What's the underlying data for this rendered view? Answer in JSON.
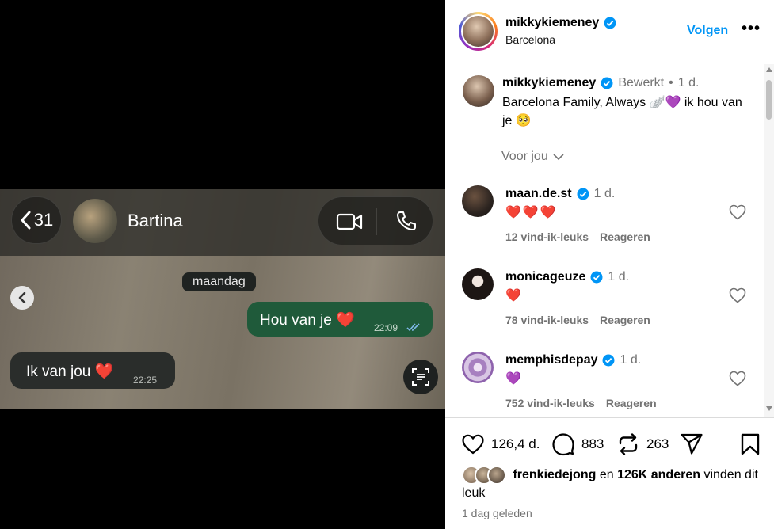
{
  "media": {
    "chat": {
      "back_count": "31",
      "contact_name": "Bartina",
      "day_label": "maandag",
      "messages": [
        {
          "direction": "out",
          "text": "Hou van je ❤️",
          "time": "22:09"
        },
        {
          "direction": "in",
          "text": "Ik van jou ❤️",
          "time": "22:25"
        }
      ]
    }
  },
  "post": {
    "header": {
      "username": "mikkykiemeney",
      "location": "Barcelona",
      "follow_label": "Volgen",
      "more_label": "•••"
    },
    "caption": {
      "username": "mikkykiemeney",
      "edited": "Bewerkt",
      "time": "1 d.",
      "text": "Barcelona Family, Always 🪽💜 ik hou van je 🥺"
    },
    "voor_jou": "Voor jou",
    "comments": [
      {
        "username": "maan.de.st",
        "time": "1 d.",
        "text": "❤️❤️❤️",
        "likes": "12 vind-ik-leuks",
        "reply": "Reageren"
      },
      {
        "username": "monicageuze",
        "time": "1 d.",
        "text": "❤️",
        "likes": "78 vind-ik-leuks",
        "reply": "Reageren"
      },
      {
        "username": "memphisdepay",
        "time": "1 d.",
        "text": "💜",
        "likes": "752 vind-ik-leuks",
        "reply": "Reageren"
      }
    ],
    "actions": {
      "likes": "126,4 d.",
      "comments": "883",
      "reposts": "263"
    },
    "liked_by": {
      "user": "frenkiedejong",
      "middle": "en",
      "others": "126K anderen",
      "suffix": "vinden dit leuk"
    },
    "posted_ago": "1 dag geleden"
  },
  "colors": {
    "accent": "#0095f6",
    "muted": "#737373",
    "out_bubble": "#1f5a3a",
    "in_bubble": "#2a2d2b"
  }
}
